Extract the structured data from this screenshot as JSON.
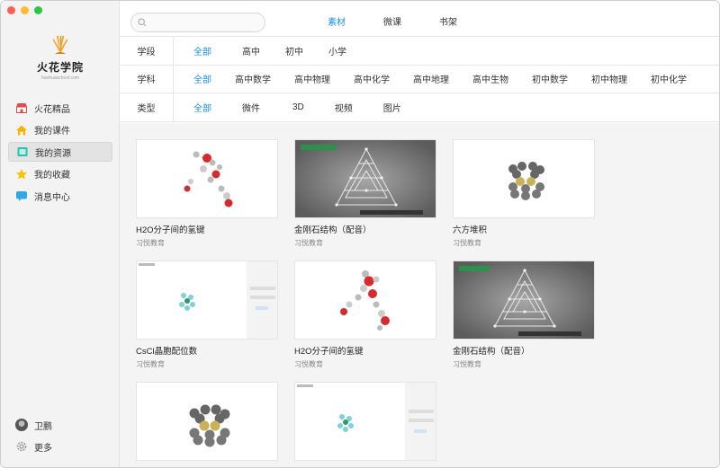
{
  "app": {
    "logo_name": "火花学院",
    "logo_sub": "huohuaschool.com"
  },
  "sidebar": {
    "items": [
      {
        "label": "火花精品",
        "icon": "store-icon"
      },
      {
        "label": "我的课件",
        "icon": "home-icon"
      },
      {
        "label": "我的资源",
        "icon": "folder-icon"
      },
      {
        "label": "我的收藏",
        "icon": "star-icon"
      },
      {
        "label": "消息中心",
        "icon": "chat-icon"
      }
    ],
    "active_index": 2,
    "user_name": "卫鹏",
    "more_label": "更多"
  },
  "search": {
    "placeholder": "",
    "value": ""
  },
  "tabs": [
    {
      "label": "素材",
      "active": true
    },
    {
      "label": "微课",
      "active": false
    },
    {
      "label": "书架",
      "active": false
    }
  ],
  "filters": {
    "stage": {
      "label": "学段",
      "options": [
        "全部",
        "高中",
        "初中",
        "小学"
      ],
      "selected": "全部"
    },
    "subject": {
      "label": "学科",
      "options": [
        "全部",
        "高中数学",
        "高中物理",
        "高中化学",
        "高中地理",
        "高中生物",
        "初中数学",
        "初中物理",
        "初中化学"
      ],
      "selected": "全部"
    },
    "type": {
      "label": "类型",
      "options": [
        "全部",
        "微件",
        "3D",
        "视频",
        "图片"
      ],
      "selected": "全部"
    }
  },
  "cards": [
    {
      "title": "H2O分子间的氢键",
      "source": "习悦教育",
      "thumb": "water"
    },
    {
      "title": "金刚石结构（配音）",
      "source": "习悦教育",
      "thumb": "diamond"
    },
    {
      "title": "六方堆积",
      "source": "习悦教育",
      "thumb": "hex"
    },
    {
      "title": "CsCl晶胞配位数",
      "source": "习悦教育",
      "thumb": "cscl"
    },
    {
      "title": "H2O分子间的氢键",
      "source": "习悦教育",
      "thumb": "water"
    },
    {
      "title": "金刚石结构（配音）",
      "source": "习悦教育",
      "thumb": "diamond"
    },
    {
      "title": "",
      "source": "",
      "thumb": "hex"
    },
    {
      "title": "",
      "source": "",
      "thumb": "cscl"
    }
  ],
  "colors": {
    "accent": "#1a8ef0",
    "sidebar_bg": "#f3f3f3",
    "grid_bg": "#f4f4f4"
  }
}
